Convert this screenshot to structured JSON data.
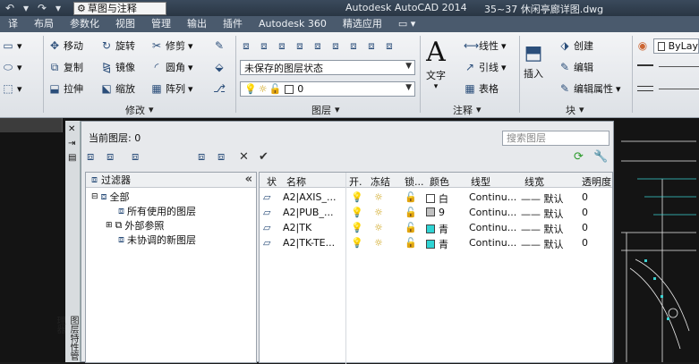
{
  "titlebar": {
    "workspace": "草图与注释",
    "app": "Autodesk AutoCAD 2014",
    "doc": "35~37 休闲亭廊详图.dwg"
  },
  "tabs": [
    "译",
    "布局",
    "参数化",
    "视图",
    "管理",
    "输出",
    "插件",
    "Autodesk 360",
    "精选应用",
    "▭ ▾"
  ],
  "modify": {
    "move": "移动",
    "rotate": "旋转",
    "trim": "修剪",
    "copy": "复制",
    "mirror": "镜像",
    "fillet": "圆角",
    "stretch": "拉伸",
    "scale": "缩放",
    "array": "阵列",
    "group": "修改"
  },
  "layer": {
    "state": "未保存的图层状态",
    "current": "0",
    "group": "图层"
  },
  "annotation": {
    "text": "文字",
    "linear": "线性",
    "leader": "引线",
    "table": "表格",
    "group": "注释"
  },
  "block": {
    "insert": "插入",
    "create": "创建",
    "edit": "编辑",
    "editattr": "编辑属性",
    "group": "块"
  },
  "props": {
    "bylayer": "ByLay"
  },
  "panel": {
    "current_layer": "当前图层: 0",
    "search_placeholder": "搜索图层",
    "vertical_title": "图层特性管理器"
  },
  "tree": {
    "header": "过滤器",
    "all": "全部",
    "used": "所有使用的图层",
    "xref": "外部参照",
    "unreconciled": "未协调的新图层"
  },
  "columns": [
    "状",
    "名称",
    "开.",
    "冻结",
    "锁...",
    "颜色",
    "线型",
    "线宽",
    "透明度"
  ],
  "layers": [
    {
      "name": "A2|AXIS_...",
      "color_name": "白",
      "swatch": "#ffffff",
      "linetype": "Continu...",
      "lineweight": "默认",
      "transparency": "0"
    },
    {
      "name": "A2|PUB_...",
      "color_name": "9",
      "swatch": "#c0c0c0",
      "linetype": "Continu...",
      "lineweight": "默认",
      "transparency": "0"
    },
    {
      "name": "A2|TK",
      "color_name": "青",
      "swatch": "#2fd4d4",
      "linetype": "Continu...",
      "lineweight": "默认",
      "transparency": "0"
    },
    {
      "name": "A2|TK-TE...",
      "color_name": "青",
      "swatch": "#2fd4d4",
      "linetype": "Continu...",
      "lineweight": "默认",
      "transparency": "0"
    }
  ]
}
